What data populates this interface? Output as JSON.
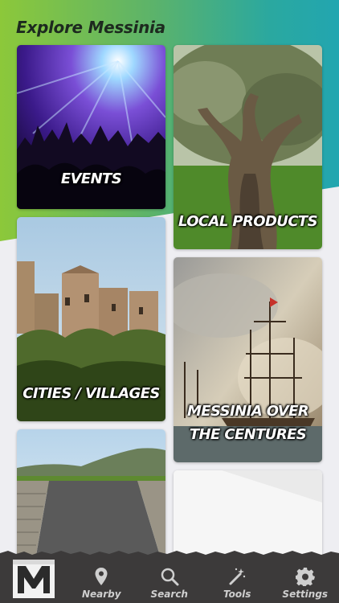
{
  "header": {
    "title": "Explore Messinia"
  },
  "tiles": [
    {
      "label": "EVENTS"
    },
    {
      "label": "LOCAL PRODUCTS"
    },
    {
      "label": "CITIES / VILLAGES"
    },
    {
      "label": "MESSINIA OVER THE CENTURES"
    }
  ],
  "tabbar": {
    "logo_icon": "messinia-logo-icon",
    "items": [
      {
        "label": "Nearby",
        "icon": "location-pin-icon"
      },
      {
        "label": "Search",
        "icon": "search-icon"
      },
      {
        "label": "Tools",
        "icon": "magic-wand-icon"
      },
      {
        "label": "Settings",
        "icon": "gear-icon"
      }
    ]
  },
  "colors": {
    "gradient_start": "#8cc83a",
    "gradient_end": "#22a6b0",
    "tabbar_bg": "#3c3a3a",
    "title": "#1d2a1f"
  }
}
